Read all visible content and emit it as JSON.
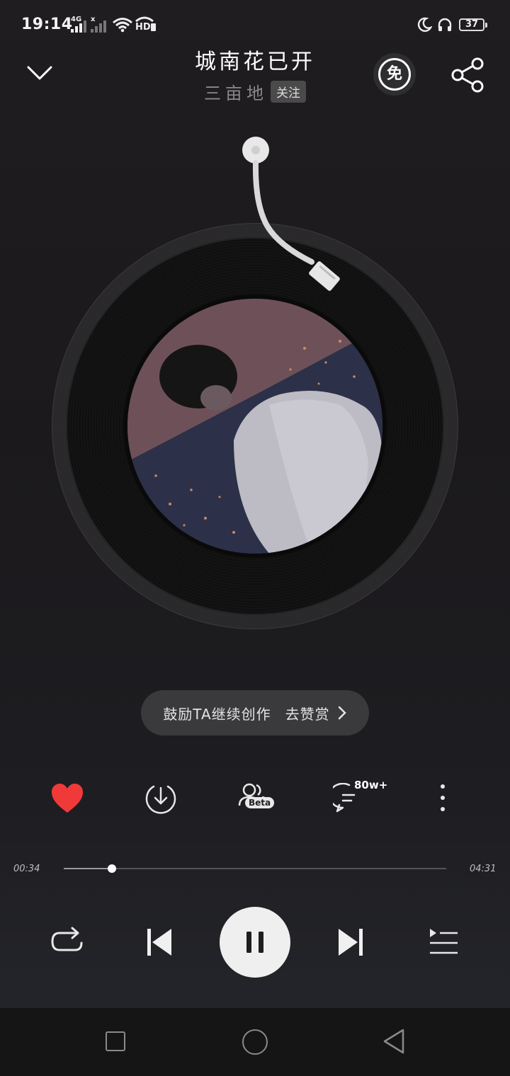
{
  "status_bar": {
    "time": "19:14",
    "network_1": "4G",
    "network_2": "x",
    "hd_label": "HD",
    "battery": "37"
  },
  "header": {
    "song_title": "城南花已开",
    "artist": "三亩地",
    "follow_label": "关注",
    "free_badge": "免"
  },
  "reward": {
    "text": "鼓励TA继续创作",
    "action": "去赞赏"
  },
  "actions": {
    "beta_label": "Beta",
    "comment_count": "80w+",
    "liked": true
  },
  "progress": {
    "current": "00:34",
    "total": "04:31",
    "fraction": 0.125
  },
  "colors": {
    "like": "#f03a3a",
    "background": "#1f1d1f"
  }
}
